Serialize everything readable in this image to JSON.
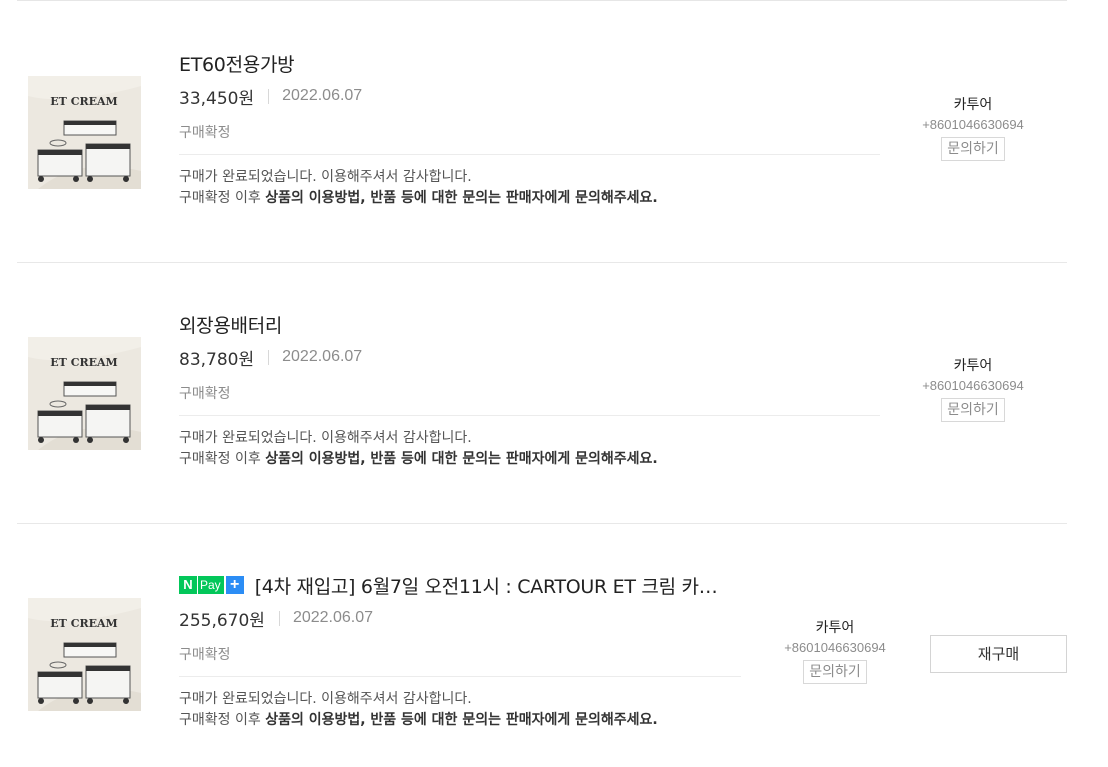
{
  "orders": [
    {
      "title": "ET60전용가방",
      "naver_pay": false,
      "price": "33,450원",
      "date": "2022.06.07",
      "status": "구매확정",
      "message_line1": "구매가 완료되었습니다. 이용해주셔서 감사합니다.",
      "message_prefix": "구매확정 이후 ",
      "message_bold": "상품의 이용방법, 반품 등에 대한 문의는 판매자에게 문의해주세요.",
      "seller_name": "카투어",
      "seller_phone": "+8601046630694",
      "inquire_label": "문의하기",
      "thumb_text": "ET CREAM"
    },
    {
      "title": "외장용배터리",
      "naver_pay": false,
      "price": "83,780원",
      "date": "2022.06.07",
      "status": "구매확정",
      "message_line1": "구매가 완료되었습니다. 이용해주셔서 감사합니다.",
      "message_prefix": "구매확정 이후 ",
      "message_bold": "상품의 이용방법, 반품 등에 대한 문의는 판매자에게 문의해주세요.",
      "seller_name": "카투어",
      "seller_phone": "+8601046630694",
      "inquire_label": "문의하기",
      "thumb_text": "ET CREAM"
    },
    {
      "title": "[4차 재입고] 6월7일 오전11시 : CARTOUR ET 크림 카…",
      "naver_pay": true,
      "naver_pay_n": "N",
      "naver_pay_text": "Pay",
      "naver_pay_plus": "+",
      "price": "255,670원",
      "date": "2022.06.07",
      "status": "구매확정",
      "message_line1": "구매가 완료되었습니다. 이용해주셔서 감사합니다.",
      "message_prefix": "구매확정 이후 ",
      "message_bold": "상품의 이용방법, 반품 등에 대한 문의는 판매자에게 문의해주세요.",
      "seller_name": "카투어",
      "seller_phone": "+8601046630694",
      "inquire_label": "문의하기",
      "rebuy_label": "재구매",
      "thumb_text": "ET CREAM"
    }
  ],
  "colors": {
    "naver_green": "#03c75a",
    "plus_blue": "#2b8df5",
    "muted_text": "#8c8c8c"
  }
}
